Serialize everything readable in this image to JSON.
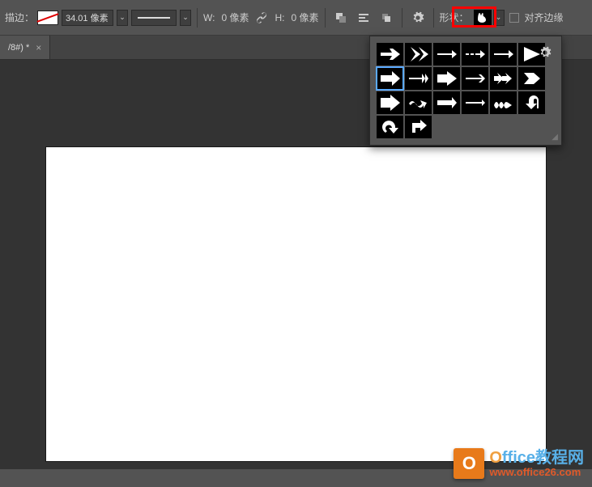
{
  "toolbar": {
    "stroke_label": "描边：",
    "size_value": "34.01 像素",
    "width_label": "W:",
    "width_value": "0 像素",
    "height_label": "H:",
    "height_value": "0 像素",
    "shape_label": "形状：",
    "shape_selected": "rabbit",
    "align_edges_label": "对齐边缘",
    "align_edges_checked": false
  },
  "tab": {
    "title": "/8#) *"
  },
  "shapes_panel": {
    "selected_index": 6,
    "shapes": [
      "arrow-feather",
      "chevron-right",
      "arrow-thin",
      "arrow-dash",
      "arrow-line",
      "triangle-right",
      "arrow-bold",
      "arrow-double-head",
      "arrow-block",
      "arrow-thin2",
      "arrow-fast",
      "arrow-tag",
      "arrow-fat",
      "wave-arrow",
      "arrow-double-line",
      "arrow-slim",
      "squiggle",
      "u-turn",
      "redo-arrow",
      "corner-arrow"
    ]
  },
  "watermark": {
    "brand_icon_letter": "O",
    "line1_a": "O",
    "line1_b": "ffice",
    "line1_c": "教程网",
    "line2": "www.office26.com"
  }
}
